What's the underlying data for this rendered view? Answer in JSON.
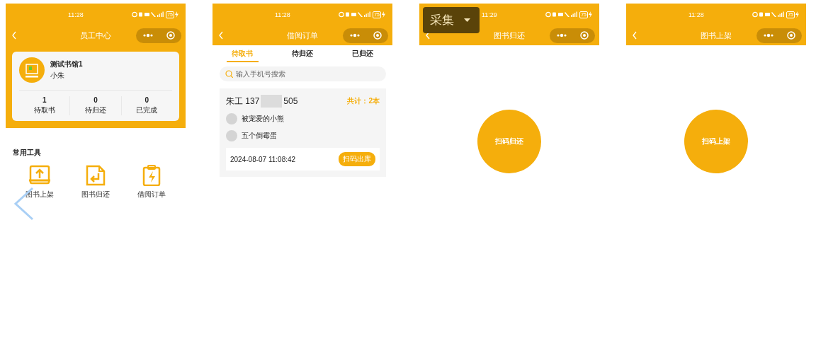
{
  "screens": [
    {
      "kind": "staff",
      "status": {
        "time": "11:28",
        "battery": "75"
      },
      "title": "员工中心",
      "profile": {
        "name": "测试书馆1",
        "user": "小朱"
      },
      "stats": [
        {
          "value": "1",
          "label": "待取书"
        },
        {
          "value": "0",
          "label": "待归还"
        },
        {
          "value": "0",
          "label": "已完成"
        }
      ],
      "tools_title": "常用工具",
      "tools": [
        {
          "kind": "upload",
          "label": "图书上架"
        },
        {
          "kind": "return",
          "label": "图书归还"
        },
        {
          "kind": "bolt",
          "label": "借阅订单"
        }
      ]
    },
    {
      "kind": "orders",
      "status": {
        "time": "11:28",
        "battery": "75"
      },
      "title": "借阅订单",
      "tabs": [
        {
          "label": "待取书",
          "selected": true
        },
        {
          "label": "待归还",
          "selected": false
        },
        {
          "label": "已归还",
          "selected": false
        }
      ],
      "search": {
        "placeholder": "输入手机号搜索"
      },
      "order": {
        "name": "朱工 137",
        "phone_tail": "505",
        "total": "共计：2本",
        "books": [
          "被宠爱的小熊",
          "五个倒霉蛋"
        ],
        "time": "2024-08-07 11:08:42",
        "action": "扫码出库"
      }
    },
    {
      "kind": "scan",
      "status": {
        "time": "11:29",
        "battery": "75"
      },
      "title": "图书归还",
      "button": "扫码归还"
    },
    {
      "kind": "scan",
      "status": {
        "time": "11:28",
        "battery": "75"
      },
      "title": "图书上架",
      "button": "扫码上架"
    }
  ],
  "overlay": {
    "label": "采集"
  }
}
